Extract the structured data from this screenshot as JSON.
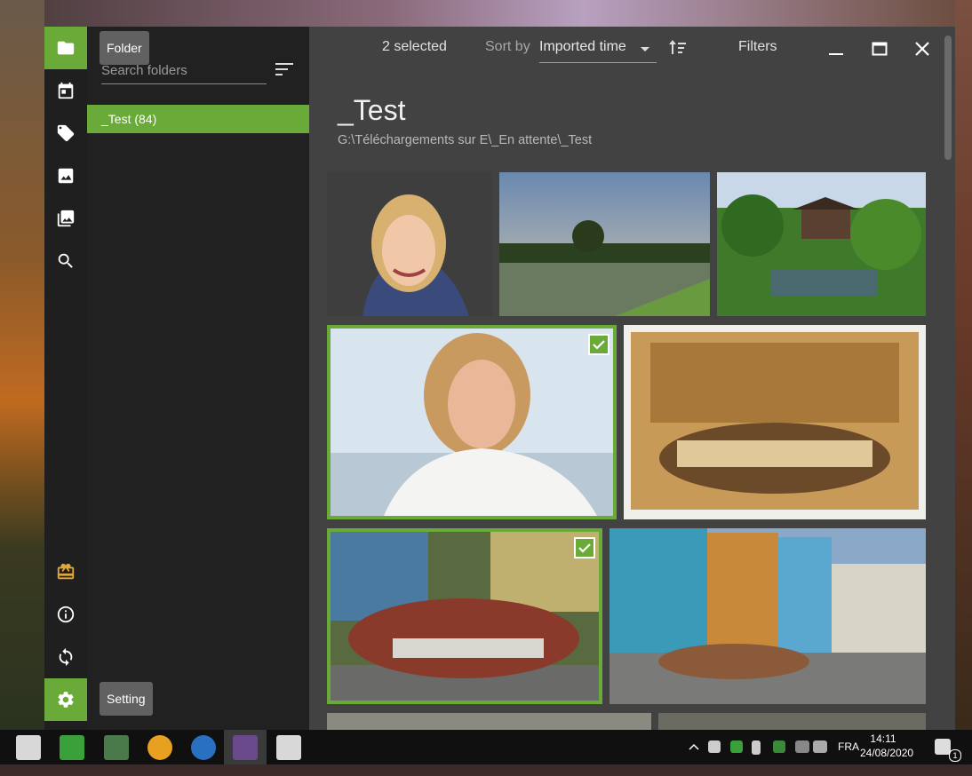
{
  "window": {
    "tooltip_folder": "Folder",
    "tooltip_setting": "Setting"
  },
  "rail": {
    "items": [
      {
        "name": "folder",
        "icon": "folder-icon",
        "active": true
      },
      {
        "name": "calendar",
        "icon": "calendar-icon"
      },
      {
        "name": "tags",
        "icon": "tag-icon"
      },
      {
        "name": "image",
        "icon": "image-icon"
      },
      {
        "name": "albums",
        "icon": "albums-icon"
      },
      {
        "name": "search",
        "icon": "search-icon"
      },
      {
        "name": "gift",
        "icon": "gift-icon"
      },
      {
        "name": "info",
        "icon": "info-icon"
      },
      {
        "name": "sync",
        "icon": "sync-icon"
      },
      {
        "name": "settings",
        "icon": "gear-icon",
        "active": true
      }
    ]
  },
  "sidebar": {
    "search_placeholder": "Search folders",
    "folders": [
      {
        "label": "_Test (84)",
        "selected": true
      }
    ]
  },
  "toolbar": {
    "selected_count": "2 selected",
    "sort_by_label": "Sort by",
    "sort_value": "Imported time",
    "filters_label": "Filters"
  },
  "content": {
    "title": "_Test",
    "path": "G:\\Téléchargements sur E\\_En attente\\_Test"
  },
  "gallery": [
    {
      "subject": "portrait woman",
      "selected": false
    },
    {
      "subject": "lake landscape",
      "selected": false
    },
    {
      "subject": "japanese garden",
      "selected": false
    },
    {
      "subject": "portrait woman smiling",
      "selected": true
    },
    {
      "subject": "sepia classic car",
      "selected": false
    },
    {
      "subject": "red classic car",
      "selected": true
    },
    {
      "subject": "havana street",
      "selected": false
    }
  ],
  "taskbar": {
    "language": "FRA",
    "time": "14:11",
    "date": "24/08/2020",
    "notification_count": "1"
  },
  "colors": {
    "accent": "#6aaa38",
    "rail_bg": "#1f1f1f",
    "panel_bg": "#212121",
    "content_bg": "#424242"
  }
}
